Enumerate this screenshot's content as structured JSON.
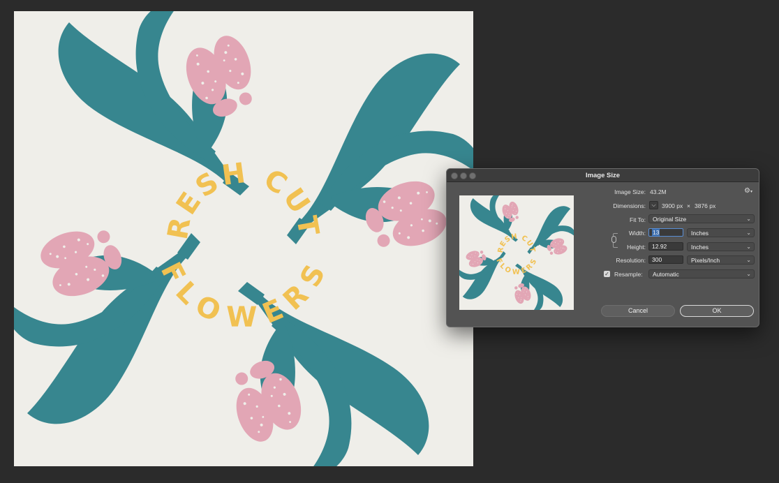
{
  "artwork": {
    "text_top": "FRESH CUTS",
    "text_bottom": "FLOWERS",
    "colors": {
      "paper": "#efeee9",
      "teal": "#37868f",
      "pink": "#e2a6b5",
      "yellow": "#f1c152"
    }
  },
  "dialog": {
    "title": "Image Size",
    "image_size": {
      "label": "Image Size:",
      "value": "43.2M"
    },
    "dimensions": {
      "label": "Dimensions:",
      "width": "3900 px",
      "times": "×",
      "height": "3876 px"
    },
    "fit_to": {
      "label": "Fit To:",
      "value": "Original Size"
    },
    "width": {
      "label": "Width:",
      "value": "13",
      "unit": "Inches"
    },
    "height": {
      "label": "Height:",
      "value": "12.92",
      "unit": "Inches"
    },
    "resolution": {
      "label": "Resolution:",
      "value": "300",
      "unit": "Pixels/Inch"
    },
    "resample": {
      "label": "Resample:",
      "checked": true,
      "value": "Automatic"
    },
    "cancel_label": "Cancel",
    "ok_label": "OK",
    "icons": [
      "gear-icon",
      "chevron-down-icon",
      "link-icon",
      "checkbox-icon"
    ]
  },
  "colors": {
    "workspace": "#2b2b2b",
    "dialog_bg": "#535353",
    "accent": "#3d6fb0"
  }
}
